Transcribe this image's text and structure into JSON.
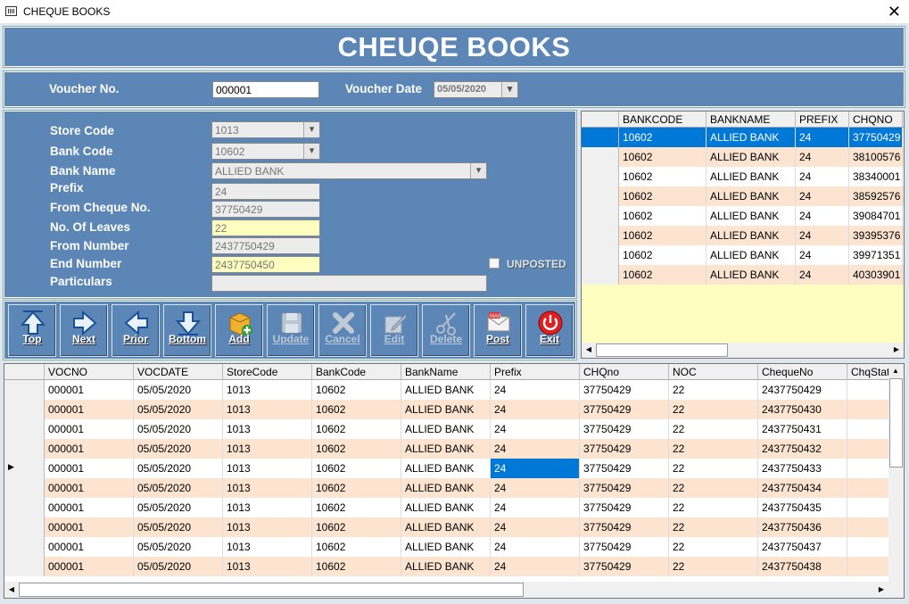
{
  "window": {
    "title": "CHEQUE BOOKS",
    "close_glyph": "✕"
  },
  "header": {
    "title": "CHEUQE BOOKS"
  },
  "voucher": {
    "no_label": "Voucher No.",
    "no_value": "000001",
    "date_label": "Voucher Date",
    "date_value": "05/05/2020"
  },
  "form": {
    "store_code_label": "Store Code",
    "store_code": "1013",
    "bank_code_label": "Bank Code",
    "bank_code": "10602",
    "bank_name_label": "Bank Name",
    "bank_name": "ALLIED BANK",
    "prefix_label": "Prefix",
    "prefix": "24",
    "from_cheque_label": "From Cheque No.",
    "from_cheque": "37750429",
    "leaves_label": "No. Of Leaves",
    "leaves": "22",
    "from_number_label": "From Number",
    "from_number": "2437750429",
    "end_number_label": "End Number",
    "end_number": "2437750450",
    "particulars_label": "Particulars",
    "particulars": "",
    "unposted_label": "UNPOSTED"
  },
  "buttons": [
    {
      "label": "Top",
      "icon": "arrow-up-icon",
      "enabled": true
    },
    {
      "label": "Next",
      "icon": "arrow-right-icon",
      "enabled": true
    },
    {
      "label": "Prior",
      "icon": "arrow-left-icon",
      "enabled": true
    },
    {
      "label": "Bottom",
      "icon": "arrow-down-icon",
      "enabled": true
    },
    {
      "label": "Add",
      "icon": "add-box-icon",
      "enabled": true
    },
    {
      "label": "Update",
      "icon": "floppy-disk-icon",
      "enabled": false
    },
    {
      "label": "Cancel",
      "icon": "cross-icon",
      "enabled": false
    },
    {
      "label": "Edit",
      "icon": "pencil-note-icon",
      "enabled": false
    },
    {
      "label": "Delete",
      "icon": "scissors-icon",
      "enabled": false
    },
    {
      "label": "Post",
      "icon": "mail-icon",
      "enabled": true
    },
    {
      "label": "Exit",
      "icon": "power-icon",
      "enabled": true
    }
  ],
  "bank_grid": {
    "columns": [
      "BANKCODE",
      "BANKNAME",
      "PREFIX",
      "CHQNO"
    ],
    "rows": [
      [
        "10602",
        "ALLIED BANK",
        "24",
        "37750429"
      ],
      [
        "10602",
        "ALLIED BANK",
        "24",
        "38100576"
      ],
      [
        "10602",
        "ALLIED BANK",
        "24",
        "38340001"
      ],
      [
        "10602",
        "ALLIED BANK",
        "24",
        "38592576"
      ],
      [
        "10602",
        "ALLIED BANK",
        "24",
        "39084701"
      ],
      [
        "10602",
        "ALLIED BANK",
        "24",
        "39395376"
      ],
      [
        "10602",
        "ALLIED BANK",
        "24",
        "39971351"
      ],
      [
        "10602",
        "ALLIED BANK",
        "24",
        "40303901"
      ]
    ]
  },
  "detail_grid": {
    "columns": [
      "VOCNO",
      "VOCDATE",
      "StoreCode",
      "BankCode",
      "BankName",
      "Prefix",
      "CHQno",
      "NOC",
      "ChequeNo",
      "ChqStat"
    ],
    "rows": [
      [
        "000001",
        "05/05/2020",
        "1013",
        "10602",
        "ALLIED BANK",
        "24",
        "37750429",
        "22",
        "2437750429",
        ""
      ],
      [
        "000001",
        "05/05/2020",
        "1013",
        "10602",
        "ALLIED BANK",
        "24",
        "37750429",
        "22",
        "2437750430",
        ""
      ],
      [
        "000001",
        "05/05/2020",
        "1013",
        "10602",
        "ALLIED BANK",
        "24",
        "37750429",
        "22",
        "2437750431",
        ""
      ],
      [
        "000001",
        "05/05/2020",
        "1013",
        "10602",
        "ALLIED BANK",
        "24",
        "37750429",
        "22",
        "2437750432",
        ""
      ],
      [
        "000001",
        "05/05/2020",
        "1013",
        "10602",
        "ALLIED BANK",
        "24",
        "37750429",
        "22",
        "2437750433",
        ""
      ],
      [
        "000001",
        "05/05/2020",
        "1013",
        "10602",
        "ALLIED BANK",
        "24",
        "37750429",
        "22",
        "2437750434",
        ""
      ],
      [
        "000001",
        "05/05/2020",
        "1013",
        "10602",
        "ALLIED BANK",
        "24",
        "37750429",
        "22",
        "2437750435",
        ""
      ],
      [
        "000001",
        "05/05/2020",
        "1013",
        "10602",
        "ALLIED BANK",
        "24",
        "37750429",
        "22",
        "2437750436",
        ""
      ],
      [
        "000001",
        "05/05/2020",
        "1013",
        "10602",
        "ALLIED BANK",
        "24",
        "37750429",
        "22",
        "2437750437",
        ""
      ],
      [
        "000001",
        "05/05/2020",
        "1013",
        "10602",
        "ALLIED BANK",
        "24",
        "37750429",
        "22",
        "2437750438",
        ""
      ]
    ],
    "current_row_marker": "▶"
  },
  "colors": {
    "panel": "#5b86b6",
    "row_alt": "#fce4d0",
    "selection": "#0078d7",
    "grid_bg": "#fdfdbf"
  }
}
